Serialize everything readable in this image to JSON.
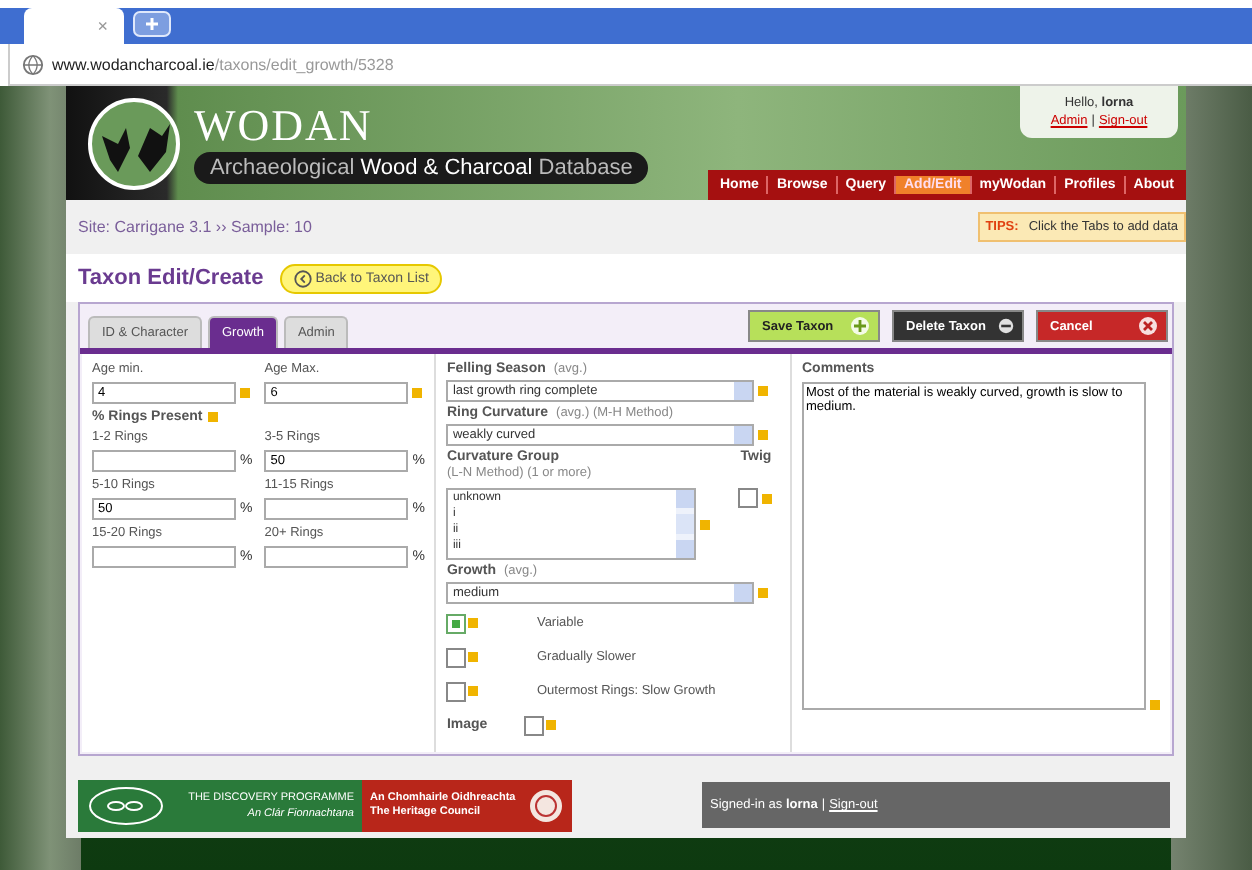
{
  "browser": {
    "tab_close": "×",
    "address": {
      "domain": "www.wodancharcoal.ie",
      "path": "/taxons/edit_growth/5328"
    }
  },
  "header": {
    "logo_title": "WODAN",
    "subtitle": "Archaeological **Wood & Charcoal** Database",
    "greeting": "Hello, **lorna**",
    "user_links": [
      "Admin",
      "Sign-out"
    ],
    "link_separator": "|",
    "nav": [
      {
        "label": "Home",
        "selected": false
      },
      {
        "label": "Browse",
        "selected": false
      },
      {
        "label": "Query",
        "selected": false
      },
      {
        "label": "Add/Edit",
        "selected": true
      },
      {
        "label": "myWodan",
        "selected": false
      },
      {
        "label": "Profiles",
        "selected": false
      },
      {
        "label": "About",
        "selected": false
      }
    ]
  },
  "breadcrumb": "Site: Carrigane 3.1 ›› Sample: 10",
  "tips": {
    "label": "TIPS:",
    "text": "Click the Tabs to add data"
  },
  "page_title": "Taxon Edit/Create",
  "back_button": "Back to Taxon List",
  "tabs": [
    {
      "label": "ID & Character",
      "selected": false
    },
    {
      "label": "Growth",
      "selected": true
    },
    {
      "label": "Admin",
      "selected": false
    }
  ],
  "actions": [
    {
      "label": "Save Taxon",
      "kind": "save"
    },
    {
      "label": "Delete Taxon",
      "kind": "delete"
    },
    {
      "label": "Cancel",
      "kind": "cancel"
    }
  ],
  "age": [
    {
      "label": "Age min.",
      "value": "4"
    },
    {
      "label": "Age Max.",
      "value": "6"
    }
  ],
  "rings_title": "% Rings Present",
  "rings": [
    {
      "label": "1-2 Rings",
      "unit": "%"
    },
    {
      "label": "3-5 Rings",
      "value": "50",
      "unit": "%"
    },
    {
      "label": "5-10 Rings",
      "value": "50",
      "unit": "%"
    },
    {
      "label": "11-15 Rings",
      "unit": "%"
    },
    {
      "label": "15-20 Rings",
      "unit": "%"
    },
    {
      "label": "20+ Rings",
      "unit": "%"
    }
  ],
  "felling_season": {
    "label": "Felling Season",
    "hint": "(avg.)",
    "value": "last growth ring complete"
  },
  "ring_curvature": {
    "label": "Ring Curvature",
    "hint": "(avg.) (M-H Method)",
    "value": "weakly curved"
  },
  "curvature_group": {
    "label": "Curvature Group",
    "hint": "(L-N Method) (1 or more)",
    "options": [
      "unknown",
      "i",
      "ii",
      "iii"
    ]
  },
  "twig": {
    "label": "Twig",
    "checked": false
  },
  "growth": {
    "label": "Growth",
    "hint": "(avg.)",
    "value": "medium"
  },
  "growth_flags": [
    {
      "label": "Variable",
      "checked": true
    },
    {
      "label": "Gradually Slower",
      "checked": false
    },
    {
      "label": "Outermost Rings: Slow Growth",
      "checked": false
    }
  ],
  "image": {
    "label": "Image",
    "checked": false
  },
  "comments": {
    "label": "Comments",
    "value": "Most of the material is weakly curved, growth is slow to medium."
  },
  "footer": {
    "discovery": [
      "THE DISCOVERY PROGRAMME",
      "An Clár Fionnachtana"
    ],
    "heritage": [
      "An Chomhairle Oidhreachta",
      "The Heritage Council"
    ],
    "signed_in": "Signed-in as **lorna**",
    "separator": "|",
    "signout": "Sign-out"
  }
}
